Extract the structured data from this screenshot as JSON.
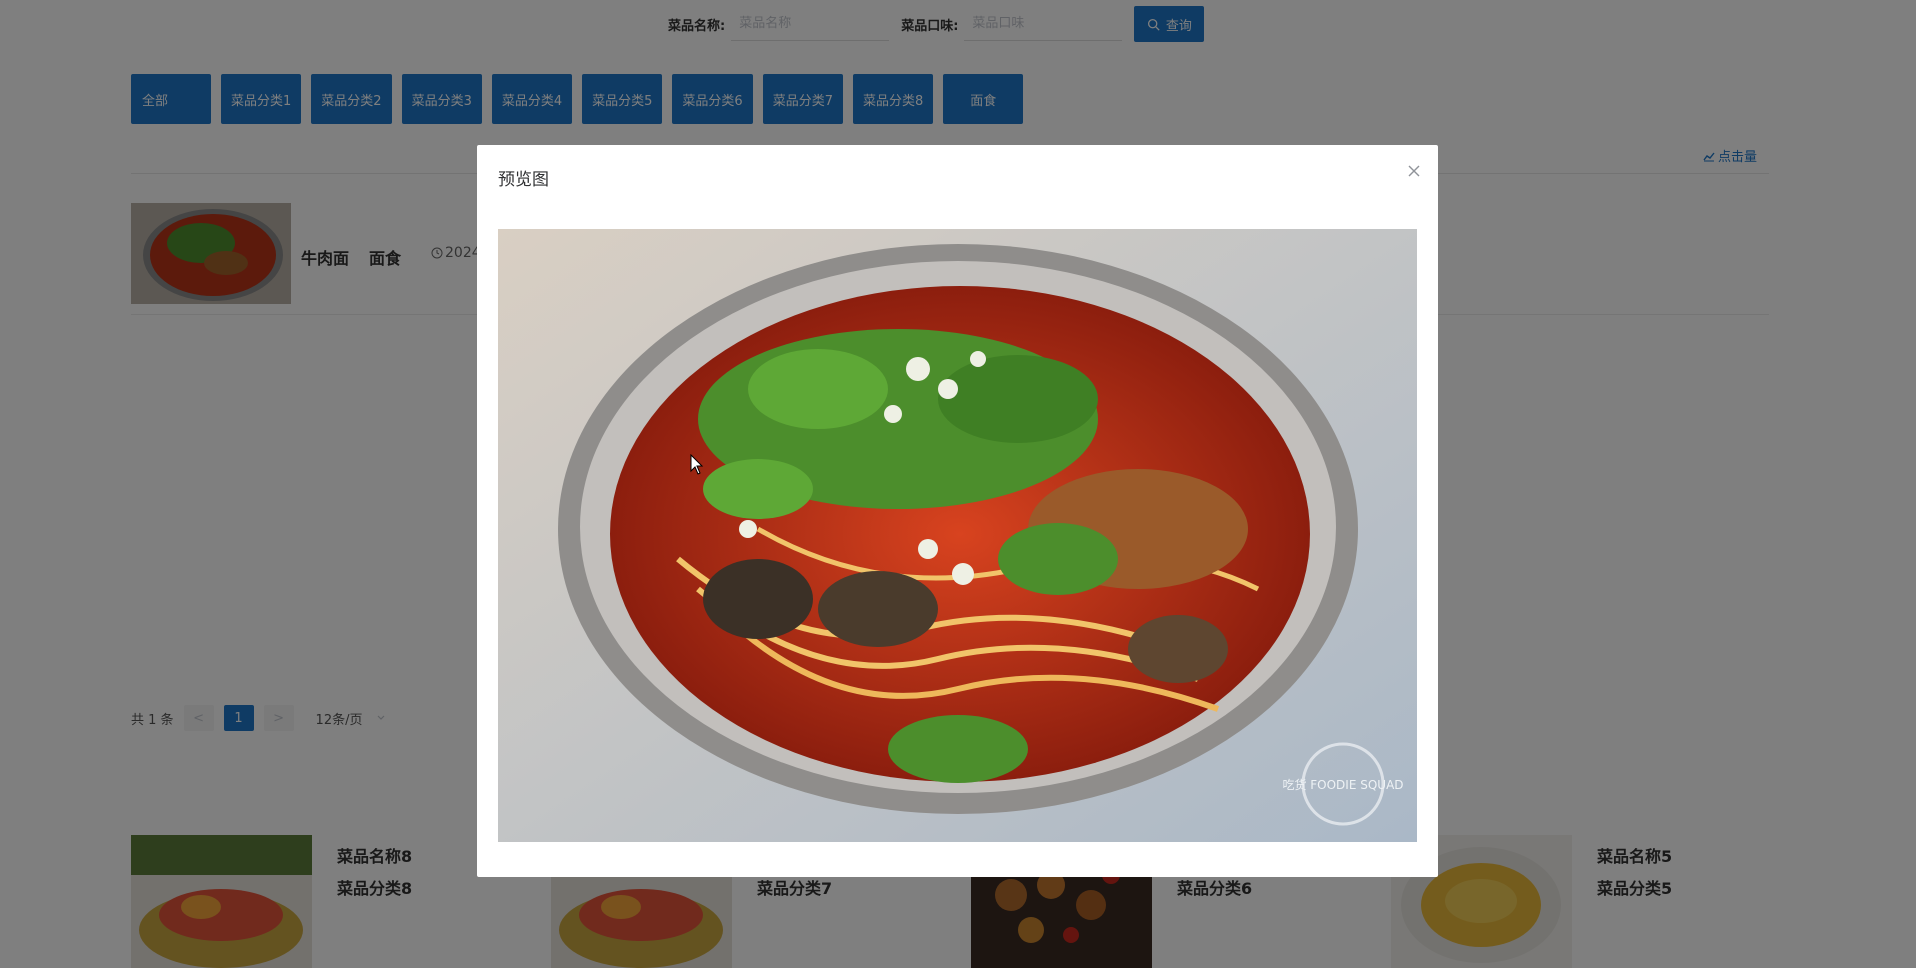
{
  "search": {
    "name_label": "菜品名称:",
    "name_placeholder": "菜品名称",
    "taste_label": "菜品口味:",
    "taste_placeholder": "菜品口味",
    "button_label": "查询"
  },
  "categories": [
    "全部",
    "菜品分类1",
    "菜品分类2",
    "菜品分类3",
    "菜品分类4",
    "菜品分类5",
    "菜品分类6",
    "菜品分类7",
    "菜品分类8",
    "面食"
  ],
  "list": {
    "sort_label": "点击量",
    "rows": [
      {
        "name": "牛肉面",
        "category": "面食",
        "date": "2024"
      }
    ]
  },
  "pagination": {
    "total": "共 1 条",
    "prev": "<",
    "page": "1",
    "next": ">",
    "page_size": "12条/页"
  },
  "recommend": [
    {
      "title": "菜品名称8",
      "category": "菜品分类8"
    },
    {
      "title": "",
      "category": "菜品分类7"
    },
    {
      "title": "",
      "category": "菜品分类6"
    },
    {
      "title": "菜品名称5",
      "category": "菜品分类5"
    }
  ],
  "dialog": {
    "title": "预览图",
    "watermark": "吃货 FOODIE SQUAD"
  },
  "colors": {
    "primary": "#1e77c8",
    "overlay": "rgba(0,0,0,0.5)"
  }
}
